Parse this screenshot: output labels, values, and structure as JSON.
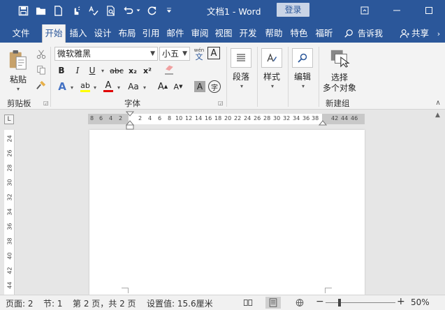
{
  "window": {
    "title": "文档1  -  Word",
    "login_label": "登录"
  },
  "tabs": [
    {
      "label": "文件"
    },
    {
      "label": "开始"
    },
    {
      "label": "插入"
    },
    {
      "label": "设计"
    },
    {
      "label": "布局"
    },
    {
      "label": "引用"
    },
    {
      "label": "邮件"
    },
    {
      "label": "审阅"
    },
    {
      "label": "视图"
    },
    {
      "label": "开发"
    },
    {
      "label": "帮助"
    },
    {
      "label": "特色"
    },
    {
      "label": "福昕"
    }
  ],
  "tell_me": "告诉我",
  "share": "共享",
  "clipboard": {
    "paste_label": "粘贴",
    "group_label": "剪贴板"
  },
  "font": {
    "font_name": "微软雅黑",
    "font_size": "小五",
    "wen_label": "wén",
    "wen_char": "文",
    "bold": "B",
    "italic": "I",
    "underline": "U",
    "strike": "abc",
    "subscript": "x₂",
    "superscript": "x²",
    "grow": "A",
    "shrink": "A",
    "change_case": "Aa",
    "char_shade": "A",
    "enclose": "字",
    "group_label": "字体"
  },
  "paragraph": {
    "label": "段落"
  },
  "styles": {
    "label": "样式"
  },
  "editing": {
    "label": "编辑"
  },
  "newgroup": {
    "button_line1": "选择",
    "button_line2": "多个对象",
    "group_label": "新建组"
  },
  "ruler": {
    "corner": "L",
    "left_ticks": [
      "8",
      "6",
      "4",
      "2"
    ],
    "ticks": [
      "2",
      "4",
      "6",
      "8",
      "10",
      "12",
      "14",
      "16",
      "18",
      "20",
      "22",
      "24",
      "26",
      "28",
      "30",
      "32",
      "34",
      "36",
      "38"
    ],
    "right_ticks": [
      "42",
      "44",
      "46"
    ],
    "v_ticks": [
      "24",
      "26",
      "28",
      "30",
      "32",
      "34",
      "36",
      "38",
      "40",
      "42",
      "44"
    ]
  },
  "status": {
    "page": "页面: 2",
    "section": "节: 1",
    "page_of": "第 2 页，共 2 页",
    "setting": "设置值: 15.6厘米",
    "zoom": "50%"
  },
  "colors": {
    "accent": "#2b579a",
    "highlight": "#ffff00",
    "font_color": "#e00000"
  }
}
